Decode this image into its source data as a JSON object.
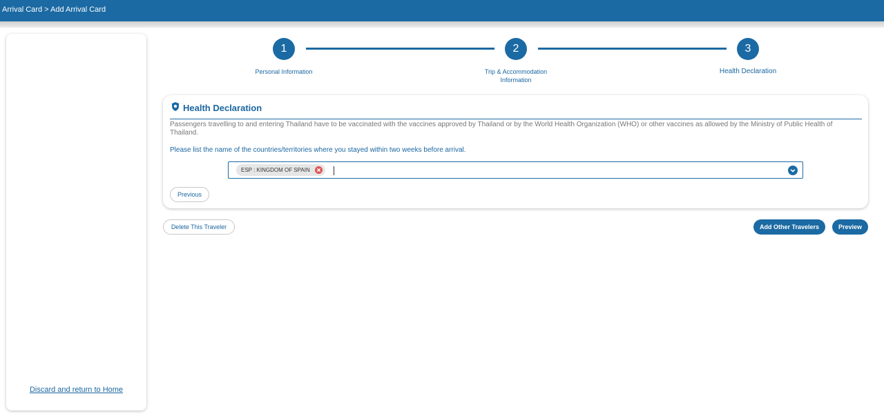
{
  "header": {
    "breadcrumb": "Arrival Card > Add Arrival Card"
  },
  "sidebar": {
    "discard_link": "Discard and return to Home"
  },
  "stepper": {
    "steps": [
      {
        "number": "1",
        "label": "Personal Information"
      },
      {
        "number": "2",
        "label_line1": "Trip & Accommodation",
        "label_line2": "Information"
      },
      {
        "number": "3",
        "label": "Health Declaration"
      }
    ]
  },
  "health": {
    "title": "Health Declaration",
    "icon": "shield-icon",
    "description": "Passengers travelling to and entering Thailand have to be vaccinated with the vaccines approved by Thailand or by the World Health Organization (WHO) or other vaccines as allowed by the Ministry of Public Health of Thailand.",
    "question": "Please list the name of the countries/territories where you stayed within two weeks before arrival.",
    "selected_countries": [
      "ESP : KINGDOM OF SPAIN"
    ],
    "previous_label": "Previous"
  },
  "actions": {
    "delete_label": "Delete This Traveler",
    "add_travelers_label": "Add Other Travelers",
    "preview_label": "Preview"
  },
  "colors": {
    "primary": "#1b6aa3",
    "chip_remove": "#e05555"
  }
}
